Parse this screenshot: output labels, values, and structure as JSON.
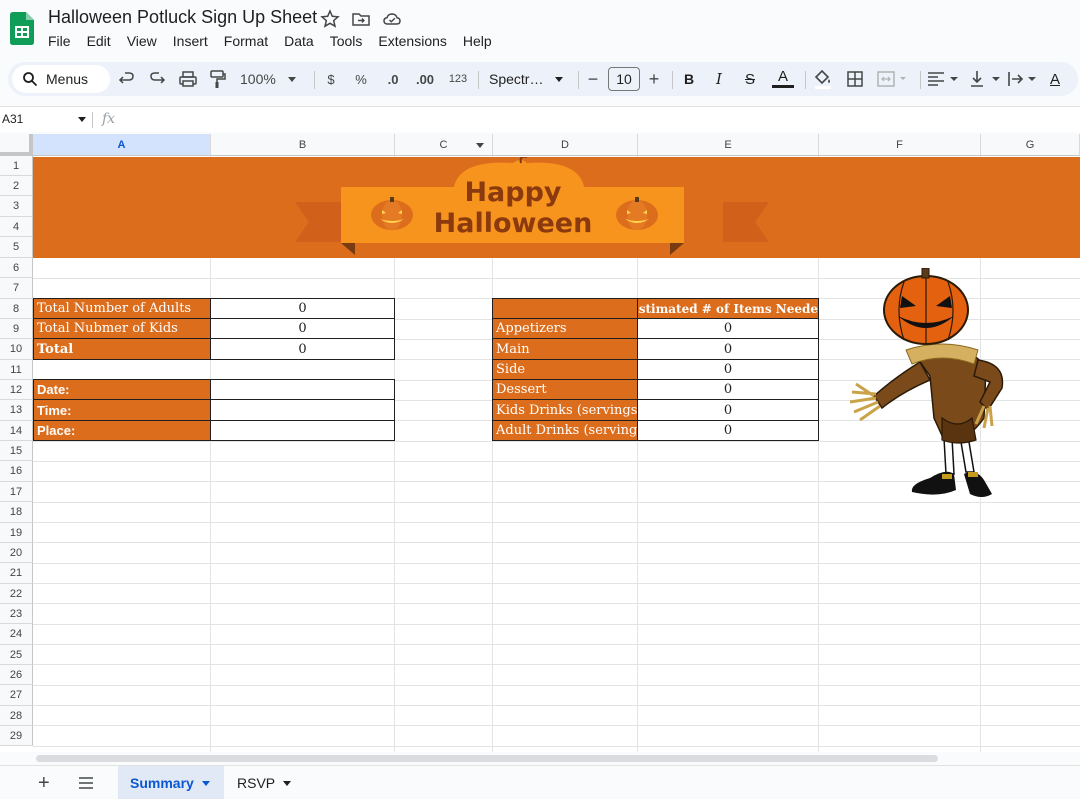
{
  "app": {
    "title": "Halloween Potluck Sign Up Sheet",
    "menu": [
      "File",
      "Edit",
      "View",
      "Insert",
      "Format",
      "Data",
      "Tools",
      "Extensions",
      "Help"
    ]
  },
  "toolbar": {
    "menus_label": "Menus",
    "zoom": "100%",
    "currency": "$",
    "percent": "%",
    "dec_decrease": ".0",
    "dec_increase": ".00",
    "number_format": "123",
    "font": "Spectr…",
    "font_size": "10",
    "minus": "−",
    "plus": "+",
    "bold": "B",
    "italic": "I",
    "strike": "S",
    "text_color": "A",
    "text_rotate": "A"
  },
  "formula_bar": {
    "cell_ref": "A31",
    "fx": "fx",
    "content": ""
  },
  "columns": [
    "A",
    "B",
    "C",
    "D",
    "E",
    "F",
    "G"
  ],
  "rows": [
    "1",
    "2",
    "3",
    "4",
    "5",
    "6",
    "7",
    "8",
    "9",
    "10",
    "11",
    "12",
    "13",
    "14",
    "15",
    "16",
    "17",
    "18",
    "19",
    "20",
    "21",
    "22",
    "23",
    "24",
    "25",
    "26",
    "27",
    "28",
    "29"
  ],
  "banner": {
    "line1": "Happy",
    "line2": "Halloween"
  },
  "summary_table": {
    "rows": [
      {
        "label": "Total Number of Adults",
        "value": "0"
      },
      {
        "label": "Total Nubmer of Kids",
        "value": "0"
      },
      {
        "label": "Total",
        "value": "0"
      }
    ]
  },
  "event_table": {
    "rows": [
      {
        "label": "Date:",
        "value": ""
      },
      {
        "label": "Time:",
        "value": ""
      },
      {
        "label": "Place:",
        "value": ""
      }
    ]
  },
  "items_table": {
    "header": "Estimated # of Items Needed",
    "rows": [
      {
        "label": "Appetizers",
        "value": "0"
      },
      {
        "label": "Main",
        "value": "0"
      },
      {
        "label": "Side",
        "value": "0"
      },
      {
        "label": "Dessert",
        "value": "0"
      },
      {
        "label": "Kids Drinks (servings)",
        "value": "0"
      },
      {
        "label": "Adult Drinks (servings)",
        "value": "0"
      }
    ]
  },
  "sheet_tabs": [
    {
      "label": "Summary",
      "active": true
    },
    {
      "label": "RSVP",
      "active": false
    }
  ],
  "colors": {
    "accent_orange": "#dc6d1c",
    "banner_ribbon": "#f7941d",
    "banner_text": "#8b3a0f",
    "selected_header": "#d3e3fd",
    "active_tab": "#e1e9f7"
  }
}
